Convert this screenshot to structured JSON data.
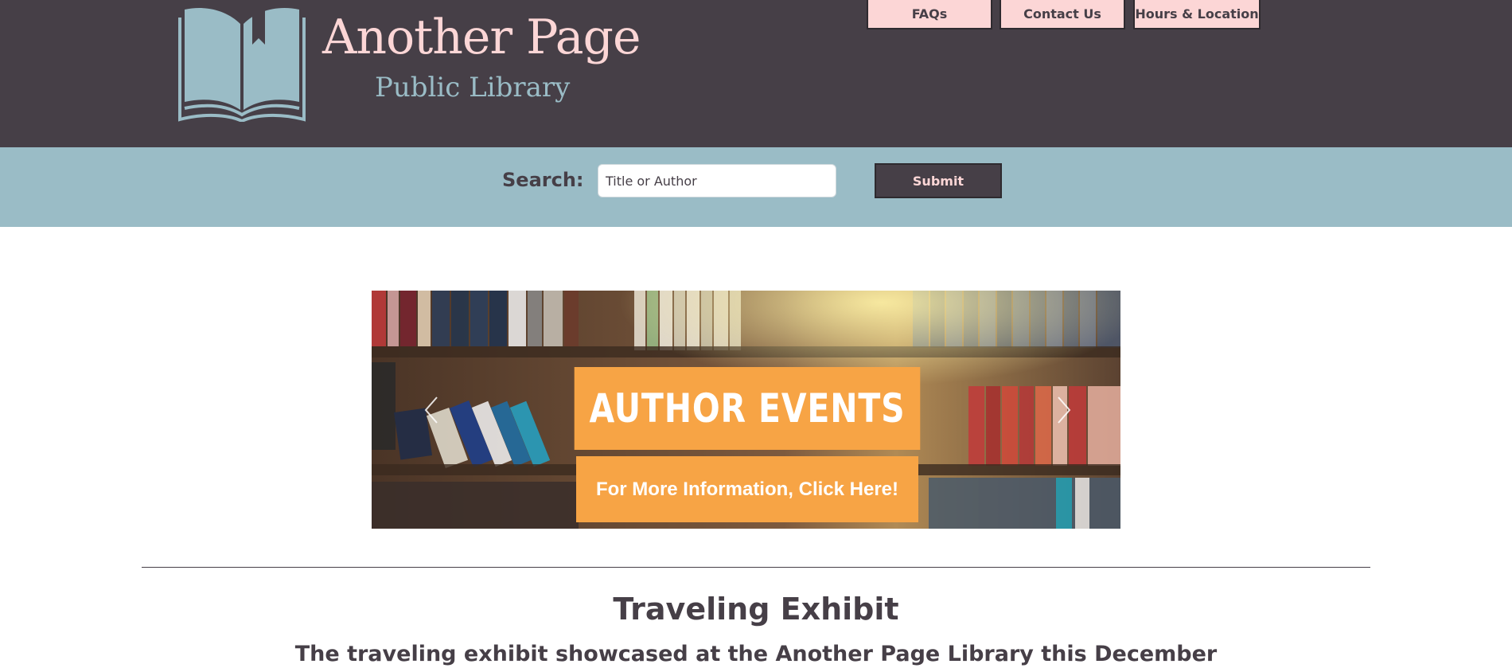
{
  "header": {
    "brand_title": "Another Page",
    "brand_subtitle": "Public Library",
    "logo_icon": "open-book-icon"
  },
  "nav": {
    "items": [
      {
        "label": "FAQs"
      },
      {
        "label": "Contact Us"
      },
      {
        "label": "Hours & Location"
      }
    ]
  },
  "search": {
    "label": "Search:",
    "placeholder": "Title or Author",
    "value": "",
    "submit_label": "Submit"
  },
  "carousel": {
    "banner_title": "AUTHOR EVENTS",
    "cta_label": "For More Information, Click Here!",
    "prev_icon": "chevron-left-icon",
    "next_icon": "chevron-right-icon"
  },
  "content": {
    "section_title": "Traveling Exhibit",
    "section_subtitle": "The traveling exhibit showcased at the Another Page Library this December"
  },
  "colors": {
    "header_bg": "#463f47",
    "brand_pink": "#fcd6d6",
    "accent_blue": "#9abcc6",
    "banner_orange": "#f7a445"
  }
}
